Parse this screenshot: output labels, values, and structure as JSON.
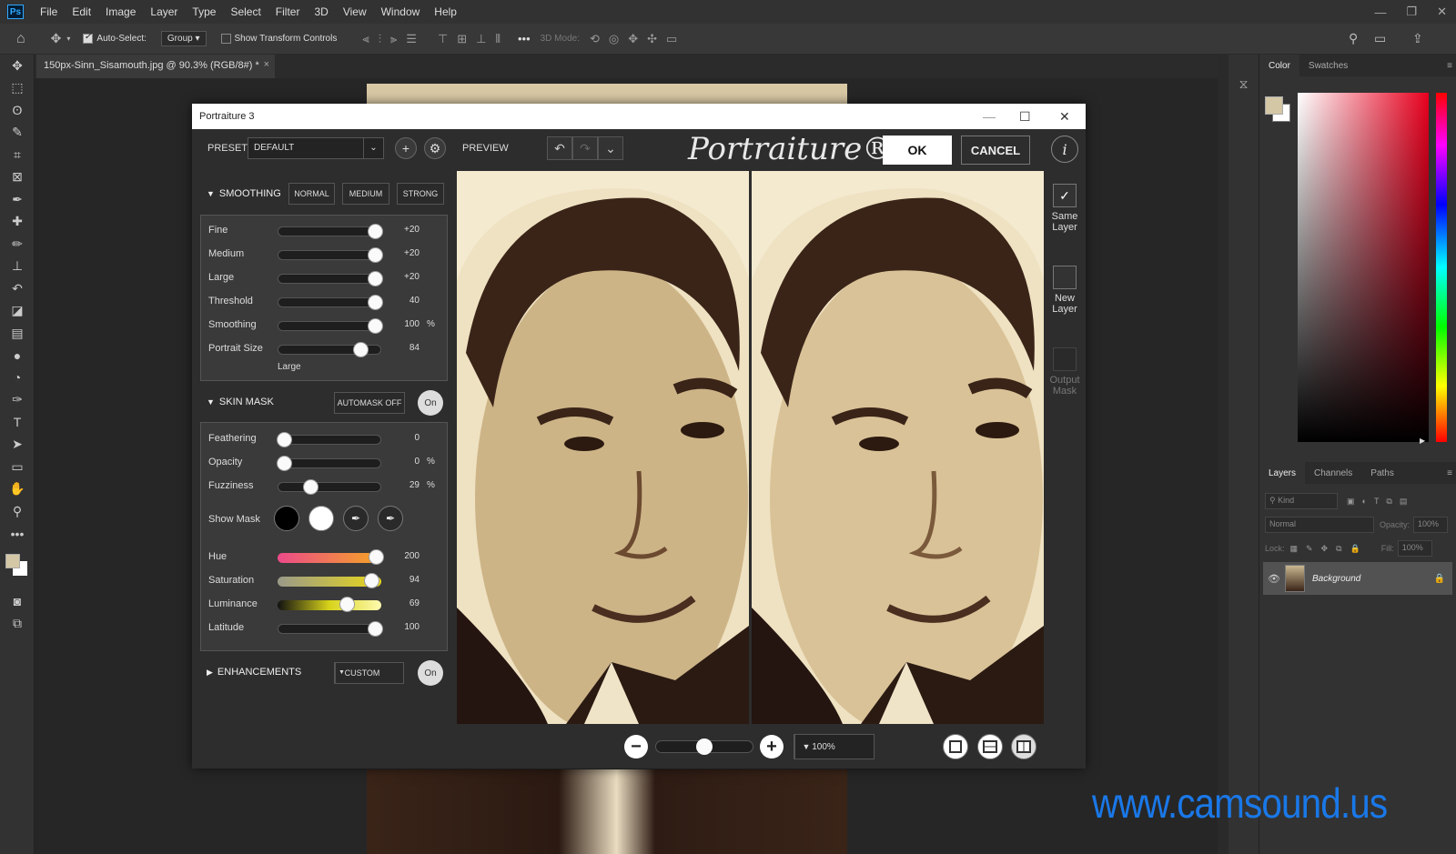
{
  "app": {
    "logo": "Ps",
    "menu": [
      "File",
      "Edit",
      "Image",
      "Layer",
      "Type",
      "Select",
      "Filter",
      "3D",
      "View",
      "Window",
      "Help"
    ],
    "window_controls": [
      "—",
      "❐",
      "✕"
    ]
  },
  "options_bar": {
    "auto_select_label": "Auto-Select:",
    "auto_select_value": "Group",
    "show_transform_label": "Show Transform Controls",
    "three_d_mode": "3D Mode:"
  },
  "document_tab": {
    "title": "150px-Sinn_Sisamouth.jpg @ 90.3% (RGB/8#) *",
    "close": "×"
  },
  "color_panel": {
    "tabs": [
      "Color",
      "Swatches"
    ],
    "foreground": "#d4c7a5",
    "background": "#ffffff"
  },
  "layers_panel": {
    "tabs": [
      "Layers",
      "Channels",
      "Paths"
    ],
    "kind_placeholder": "Kind",
    "blend_mode": "Normal",
    "opacity_label": "Opacity:",
    "opacity_value": "100%",
    "lock_label": "Lock:",
    "fill_label": "Fill:",
    "fill_value": "100%",
    "layer_name": "Background"
  },
  "dialog": {
    "title": "Portraiture 3",
    "window_controls": [
      "—",
      "☐",
      "✕"
    ],
    "preset_label": "PRESET",
    "preset_value": "DEFAULT",
    "preview_label": "PREVIEW",
    "brand": "Portraiture® 3",
    "ok": "OK",
    "cancel": "CANCEL",
    "info": "i",
    "smoothing": {
      "header": "SMOOTHING",
      "buttons": [
        "NORMAL",
        "MEDIUM",
        "STRONG"
      ],
      "sliders": [
        {
          "label": "Fine",
          "value": "+20",
          "unit": "",
          "pos": 0.95
        },
        {
          "label": "Medium",
          "value": "+20",
          "unit": "",
          "pos": 0.95
        },
        {
          "label": "Large",
          "value": "+20",
          "unit": "",
          "pos": 0.95
        },
        {
          "label": "Threshold",
          "value": "40",
          "unit": "",
          "pos": 0.95
        },
        {
          "label": "Smoothing",
          "value": "100",
          "unit": "%",
          "pos": 0.95
        },
        {
          "label": "Portrait Size",
          "value": "84",
          "unit": "",
          "pos": 0.8
        }
      ],
      "portrait_size_text": "Large"
    },
    "skin_mask": {
      "header": "SKIN MASK",
      "automask": "AUTOMASK OFF",
      "on": "On",
      "sliders": [
        {
          "label": "Feathering",
          "value": "0",
          "unit": "",
          "pos": 0.05
        },
        {
          "label": "Opacity",
          "value": "0",
          "unit": "%",
          "pos": 0.05
        },
        {
          "label": "Fuzziness",
          "value": "29",
          "unit": "%",
          "pos": 0.31
        }
      ],
      "show_mask_label": "Show Mask",
      "hsl": [
        {
          "label": "Hue",
          "value": "200",
          "pos": 0.95
        },
        {
          "label": "Saturation",
          "value": "94",
          "pos": 0.9
        },
        {
          "label": "Luminance",
          "value": "69",
          "pos": 0.67
        },
        {
          "label": "Latitude",
          "value": "100",
          "pos": 0.95
        }
      ]
    },
    "enhancements": {
      "header": "ENHANCEMENTS",
      "mode": "CUSTOM",
      "on": "On"
    },
    "output": [
      {
        "label": "Same Layer",
        "checked": true
      },
      {
        "label": "New Layer",
        "checked": false
      },
      {
        "label": "Output Mask",
        "checked": false
      }
    ],
    "zoom": {
      "value": "100%",
      "pos": 0.5
    }
  },
  "watermark": "www.camsound.us"
}
